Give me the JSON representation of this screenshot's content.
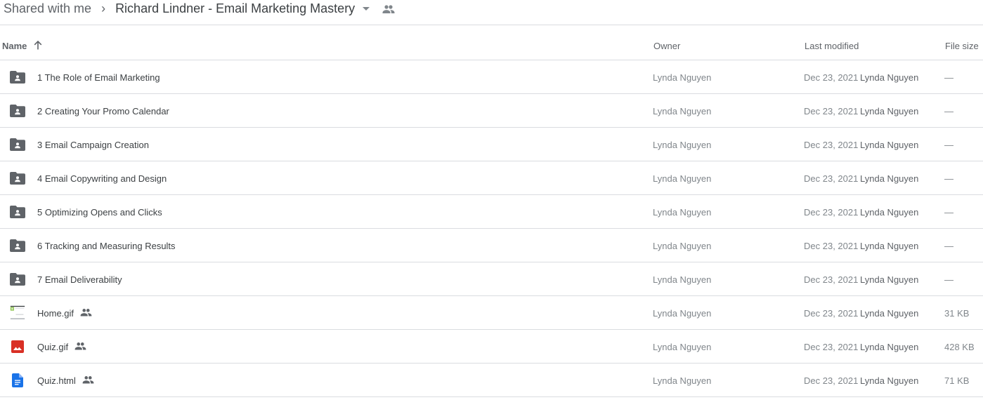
{
  "breadcrumb": {
    "root": "Shared with me",
    "separator": "›",
    "current": "Richard Lindner - Email Marketing Mastery",
    "icons": {
      "caret": "caret-down-icon",
      "shared": "people-icon"
    }
  },
  "table": {
    "columns": {
      "name": "Name",
      "owner": "Owner",
      "last_modified": "Last modified",
      "file_size": "File size"
    },
    "sort": {
      "column": "Name",
      "direction": "ascending",
      "icon": "arrow-up-icon"
    },
    "rows": [
      {
        "type": "shared-folder",
        "icon": "shared-folder-icon",
        "name": "1 The Role of Email Marketing",
        "shared": false,
        "owner": "Lynda Nguyen",
        "modified_date": "Dec 23, 2021",
        "modified_by": "Lynda Nguyen",
        "size": "—"
      },
      {
        "type": "shared-folder",
        "icon": "shared-folder-icon",
        "name": "2 Creating Your Promo Calendar",
        "shared": false,
        "owner": "Lynda Nguyen",
        "modified_date": "Dec 23, 2021",
        "modified_by": "Lynda Nguyen",
        "size": "—"
      },
      {
        "type": "shared-folder",
        "icon": "shared-folder-icon",
        "name": "3 Email Campaign Creation",
        "shared": false,
        "owner": "Lynda Nguyen",
        "modified_date": "Dec 23, 2021",
        "modified_by": "Lynda Nguyen",
        "size": "—"
      },
      {
        "type": "shared-folder",
        "icon": "shared-folder-icon",
        "name": "4 Email Copywriting and Design",
        "shared": false,
        "owner": "Lynda Nguyen",
        "modified_date": "Dec 23, 2021",
        "modified_by": "Lynda Nguyen",
        "size": "—"
      },
      {
        "type": "shared-folder",
        "icon": "shared-folder-icon",
        "name": "5 Optimizing Opens and Clicks",
        "shared": false,
        "owner": "Lynda Nguyen",
        "modified_date": "Dec 23, 2021",
        "modified_by": "Lynda Nguyen",
        "size": "—"
      },
      {
        "type": "shared-folder",
        "icon": "shared-folder-icon",
        "name": "6 Tracking and Measuring Results",
        "shared": false,
        "owner": "Lynda Nguyen",
        "modified_date": "Dec 23, 2021",
        "modified_by": "Lynda Nguyen",
        "size": "—"
      },
      {
        "type": "shared-folder",
        "icon": "shared-folder-icon",
        "name": "7 Email Deliverability",
        "shared": false,
        "owner": "Lynda Nguyen",
        "modified_date": "Dec 23, 2021",
        "modified_by": "Lynda Nguyen",
        "size": "—"
      },
      {
        "type": "image-thumbnail",
        "icon": "image-thumbnail-icon",
        "name": "Home.gif",
        "shared": true,
        "owner": "Lynda Nguyen",
        "modified_date": "Dec 23, 2021",
        "modified_by": "Lynda Nguyen",
        "size": "31 KB"
      },
      {
        "type": "image",
        "icon": "image-file-icon",
        "name": "Quiz.gif",
        "shared": true,
        "owner": "Lynda Nguyen",
        "modified_date": "Dec 23, 2021",
        "modified_by": "Lynda Nguyen",
        "size": "428 KB"
      },
      {
        "type": "document",
        "icon": "document-file-icon",
        "name": "Quiz.html",
        "shared": true,
        "owner": "Lynda Nguyen",
        "modified_date": "Dec 23, 2021",
        "modified_by": "Lynda Nguyen",
        "size": "71 KB"
      }
    ]
  },
  "colors": {
    "folder": "#5f6368",
    "image_red": "#d93025",
    "doc_blue": "#1a73e8",
    "thumb_green": "#8bc34a",
    "divider": "#dadce0"
  }
}
